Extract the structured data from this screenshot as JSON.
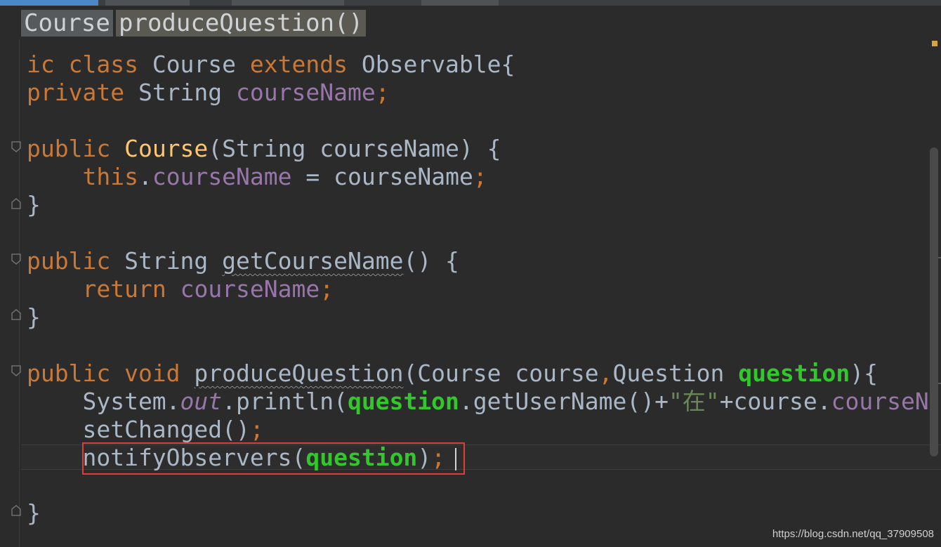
{
  "breadcrumb": {
    "class_name": "Course",
    "method_name": "produceQuestion()"
  },
  "colors": {
    "background": "#2b2b2b",
    "keyword": "#cc7832",
    "field": "#9876aa",
    "method_decl": "#ffc66d",
    "parameter": "#32c72b",
    "string": "#6a8759",
    "default": "#a9b7c6",
    "highlight_box": "#e33a3a"
  },
  "code": {
    "l1": {
      "t1": "ic class",
      "t2": " Course ",
      "t3": "extends",
      "t4": " Observable{"
    },
    "l2": {
      "t1": "private",
      "t2": " String ",
      "t3": "courseName",
      "t4": ";"
    },
    "l4": {
      "t1": "public ",
      "t2": "Course",
      "t3": "(String courseName) {"
    },
    "l5": {
      "t1": "    ",
      "t2": "this",
      "t3": ".",
      "t4": "courseName",
      "t5": " = courseName",
      "t6": ";"
    },
    "l6": {
      "t1": "}"
    },
    "l8": {
      "t1": "public",
      "t2": " String ",
      "t3": "getCourseName",
      "t4": "() {"
    },
    "l9": {
      "t1": "    ",
      "t2": "return",
      "t3": " ",
      "t4": "courseName",
      "t5": ";"
    },
    "l10": {
      "t1": "}"
    },
    "l12": {
      "t1": "public void",
      "t2": " ",
      "t3": "produceQuestion",
      "t4": "(Course course",
      "t5": ",",
      "t6": "Question ",
      "t7": "question",
      "t8": "){"
    },
    "l13": {
      "t1": "    System.",
      "t2": "out",
      "t3": ".println(",
      "t4": "question",
      "t5": ".getUserName()+",
      "t6": "\"在\"",
      "t7": "+course.",
      "t8": "courseN"
    },
    "l14": {
      "t1": "    setChanged()",
      "t2": ";"
    },
    "l15": {
      "t1": "    notifyObservers(",
      "t2": "question",
      "t3": ")",
      "t4": ";"
    },
    "l17": {
      "t1": "}"
    }
  },
  "watermark": "https://blog.csdn.net/qq_37909508"
}
